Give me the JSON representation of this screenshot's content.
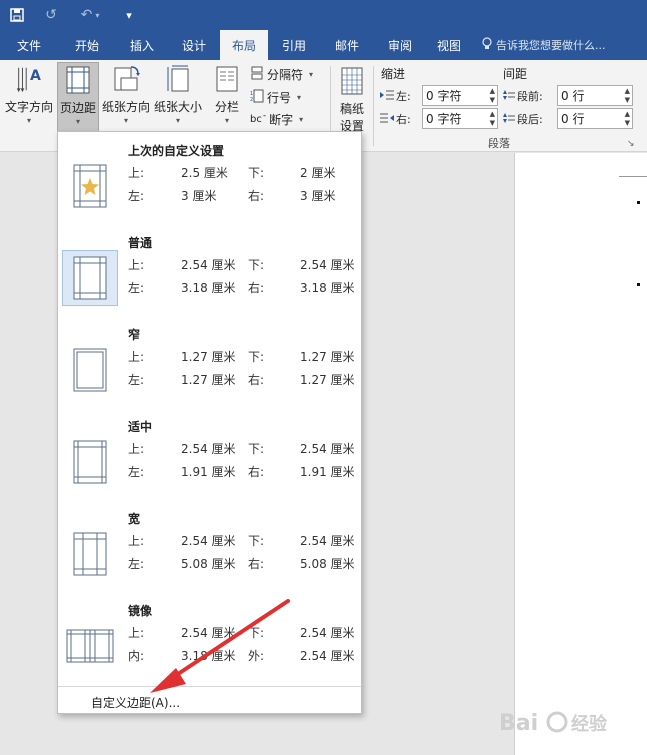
{
  "quick_access": {
    "save_icon": "save-icon",
    "redo_icon": "redo-icon",
    "undo_icon": "undo-icon",
    "customize_icon": "customize-arrow-icon"
  },
  "tabs": [
    {
      "label": "文件"
    },
    {
      "label": "开始"
    },
    {
      "label": "插入"
    },
    {
      "label": "设计"
    },
    {
      "label": "布局",
      "active": true
    },
    {
      "label": "引用"
    },
    {
      "label": "邮件"
    },
    {
      "label": "审阅"
    },
    {
      "label": "视图"
    }
  ],
  "tell_me": "告诉我您想要做什么...",
  "ribbon": {
    "text_direction": "文字方向",
    "margins": "页边距",
    "orientation": "纸张方向",
    "size": "纸张大小",
    "columns": "分栏",
    "breaks": "分隔符",
    "line_numbers": "行号",
    "hyphenation": "断字",
    "paper_settings_line1": "稿纸",
    "paper_settings_line2": "设置",
    "indent_title": "缩进",
    "spacing_title": "间距",
    "indent_left_label": "左:",
    "indent_left_value": "0 字符",
    "indent_right_label": "右:",
    "indent_right_value": "0 字符",
    "spacing_before_label": "段前:",
    "spacing_before_value": "0 行",
    "spacing_after_label": "段后:",
    "spacing_after_value": "0 行",
    "paragraph_group": "段落",
    "hyphenation_prefix": "bc"
  },
  "margins_menu": {
    "items": [
      {
        "title": "上次的自定义设置",
        "top_label": "上:",
        "top": "2.5 厘米",
        "bottom_label": "下:",
        "bottom": "2 厘米",
        "left_label": "左:",
        "left": "3 厘米",
        "right_label": "右:",
        "right": "3 厘米"
      },
      {
        "title": "普通",
        "top_label": "上:",
        "top": "2.54 厘米",
        "bottom_label": "下:",
        "bottom": "2.54 厘米",
        "left_label": "左:",
        "left": "3.18 厘米",
        "right_label": "右:",
        "right": "3.18 厘米"
      },
      {
        "title": "窄",
        "top_label": "上:",
        "top": "1.27 厘米",
        "bottom_label": "下:",
        "bottom": "1.27 厘米",
        "left_label": "左:",
        "left": "1.27 厘米",
        "right_label": "右:",
        "right": "1.27 厘米"
      },
      {
        "title": "适中",
        "top_label": "上:",
        "top": "2.54 厘米",
        "bottom_label": "下:",
        "bottom": "2.54 厘米",
        "left_label": "左:",
        "left": "1.91 厘米",
        "right_label": "右:",
        "right": "1.91 厘米"
      },
      {
        "title": "宽",
        "top_label": "上:",
        "top": "2.54 厘米",
        "bottom_label": "下:",
        "bottom": "2.54 厘米",
        "left_label": "左:",
        "left": "5.08 厘米",
        "right_label": "右:",
        "right": "5.08 厘米"
      },
      {
        "title": "镜像",
        "top_label": "上:",
        "top": "2.54 厘米",
        "bottom_label": "下:",
        "bottom": "2.54 厘米",
        "left_label": "内:",
        "left": "3.18 厘米",
        "right_label": "外:",
        "right": "2.54 厘米"
      }
    ],
    "custom_margins": "自定义边距(A)..."
  },
  "colors": {
    "brand": "#2b579a",
    "arrow": "#e03030"
  },
  "watermark": "Bai 经验"
}
